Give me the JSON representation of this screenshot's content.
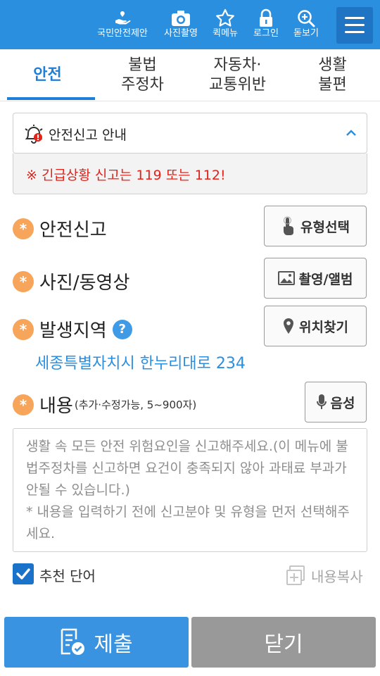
{
  "header": {
    "items": [
      {
        "label": "국민안전제안",
        "icon": "hand-heart-icon"
      },
      {
        "label": "사진촬영",
        "icon": "camera-icon"
      },
      {
        "label": "퀵메뉴",
        "icon": "star-icon"
      },
      {
        "label": "로그인",
        "icon": "lock-icon"
      },
      {
        "label": "돋보기",
        "icon": "zoom-in-icon"
      }
    ],
    "menu_icon": "hamburger-menu-icon",
    "color": "#2b8fe0"
  },
  "tabs": [
    {
      "label": "안전",
      "active": true
    },
    {
      "label": "불법\n주정차",
      "active": false
    },
    {
      "label": "자동차·\n교통위반",
      "active": false
    },
    {
      "label": "생활\n불편",
      "active": false
    }
  ],
  "notice": {
    "title": "안전신고 안내",
    "message": "※ 긴급상황 신고는 119 또는 112!"
  },
  "form": {
    "report_label": "안전신고",
    "type_button": "유형선택",
    "media_label": "사진/동영상",
    "media_button": "촬영/앨범",
    "location_label": "발생지역",
    "help_mark": "?",
    "location_button": "위치찾기",
    "address": "세종특별자치시 한누리대로 234",
    "content_label": "내용",
    "content_hint": "(추가·수정가능, 5~900자)",
    "voice_button": "음성",
    "content_placeholder": "생활 속 모든 안전 위험요인을 신고해주세요.(이 메뉴에 불법주정차를 신고하면 요건이 충족되지 않아 과태료 부과가 안될 수 있습니다.)\n* 내용을 입력하기 전에 신고분야 및 유형을 먼저 선택해주세요.",
    "recommend_label": "추천 단어",
    "recommend_checked": true,
    "copy_label": "내용복사",
    "required_mark": "*"
  },
  "footer": {
    "submit_label": "제출",
    "close_label": "닫기"
  }
}
